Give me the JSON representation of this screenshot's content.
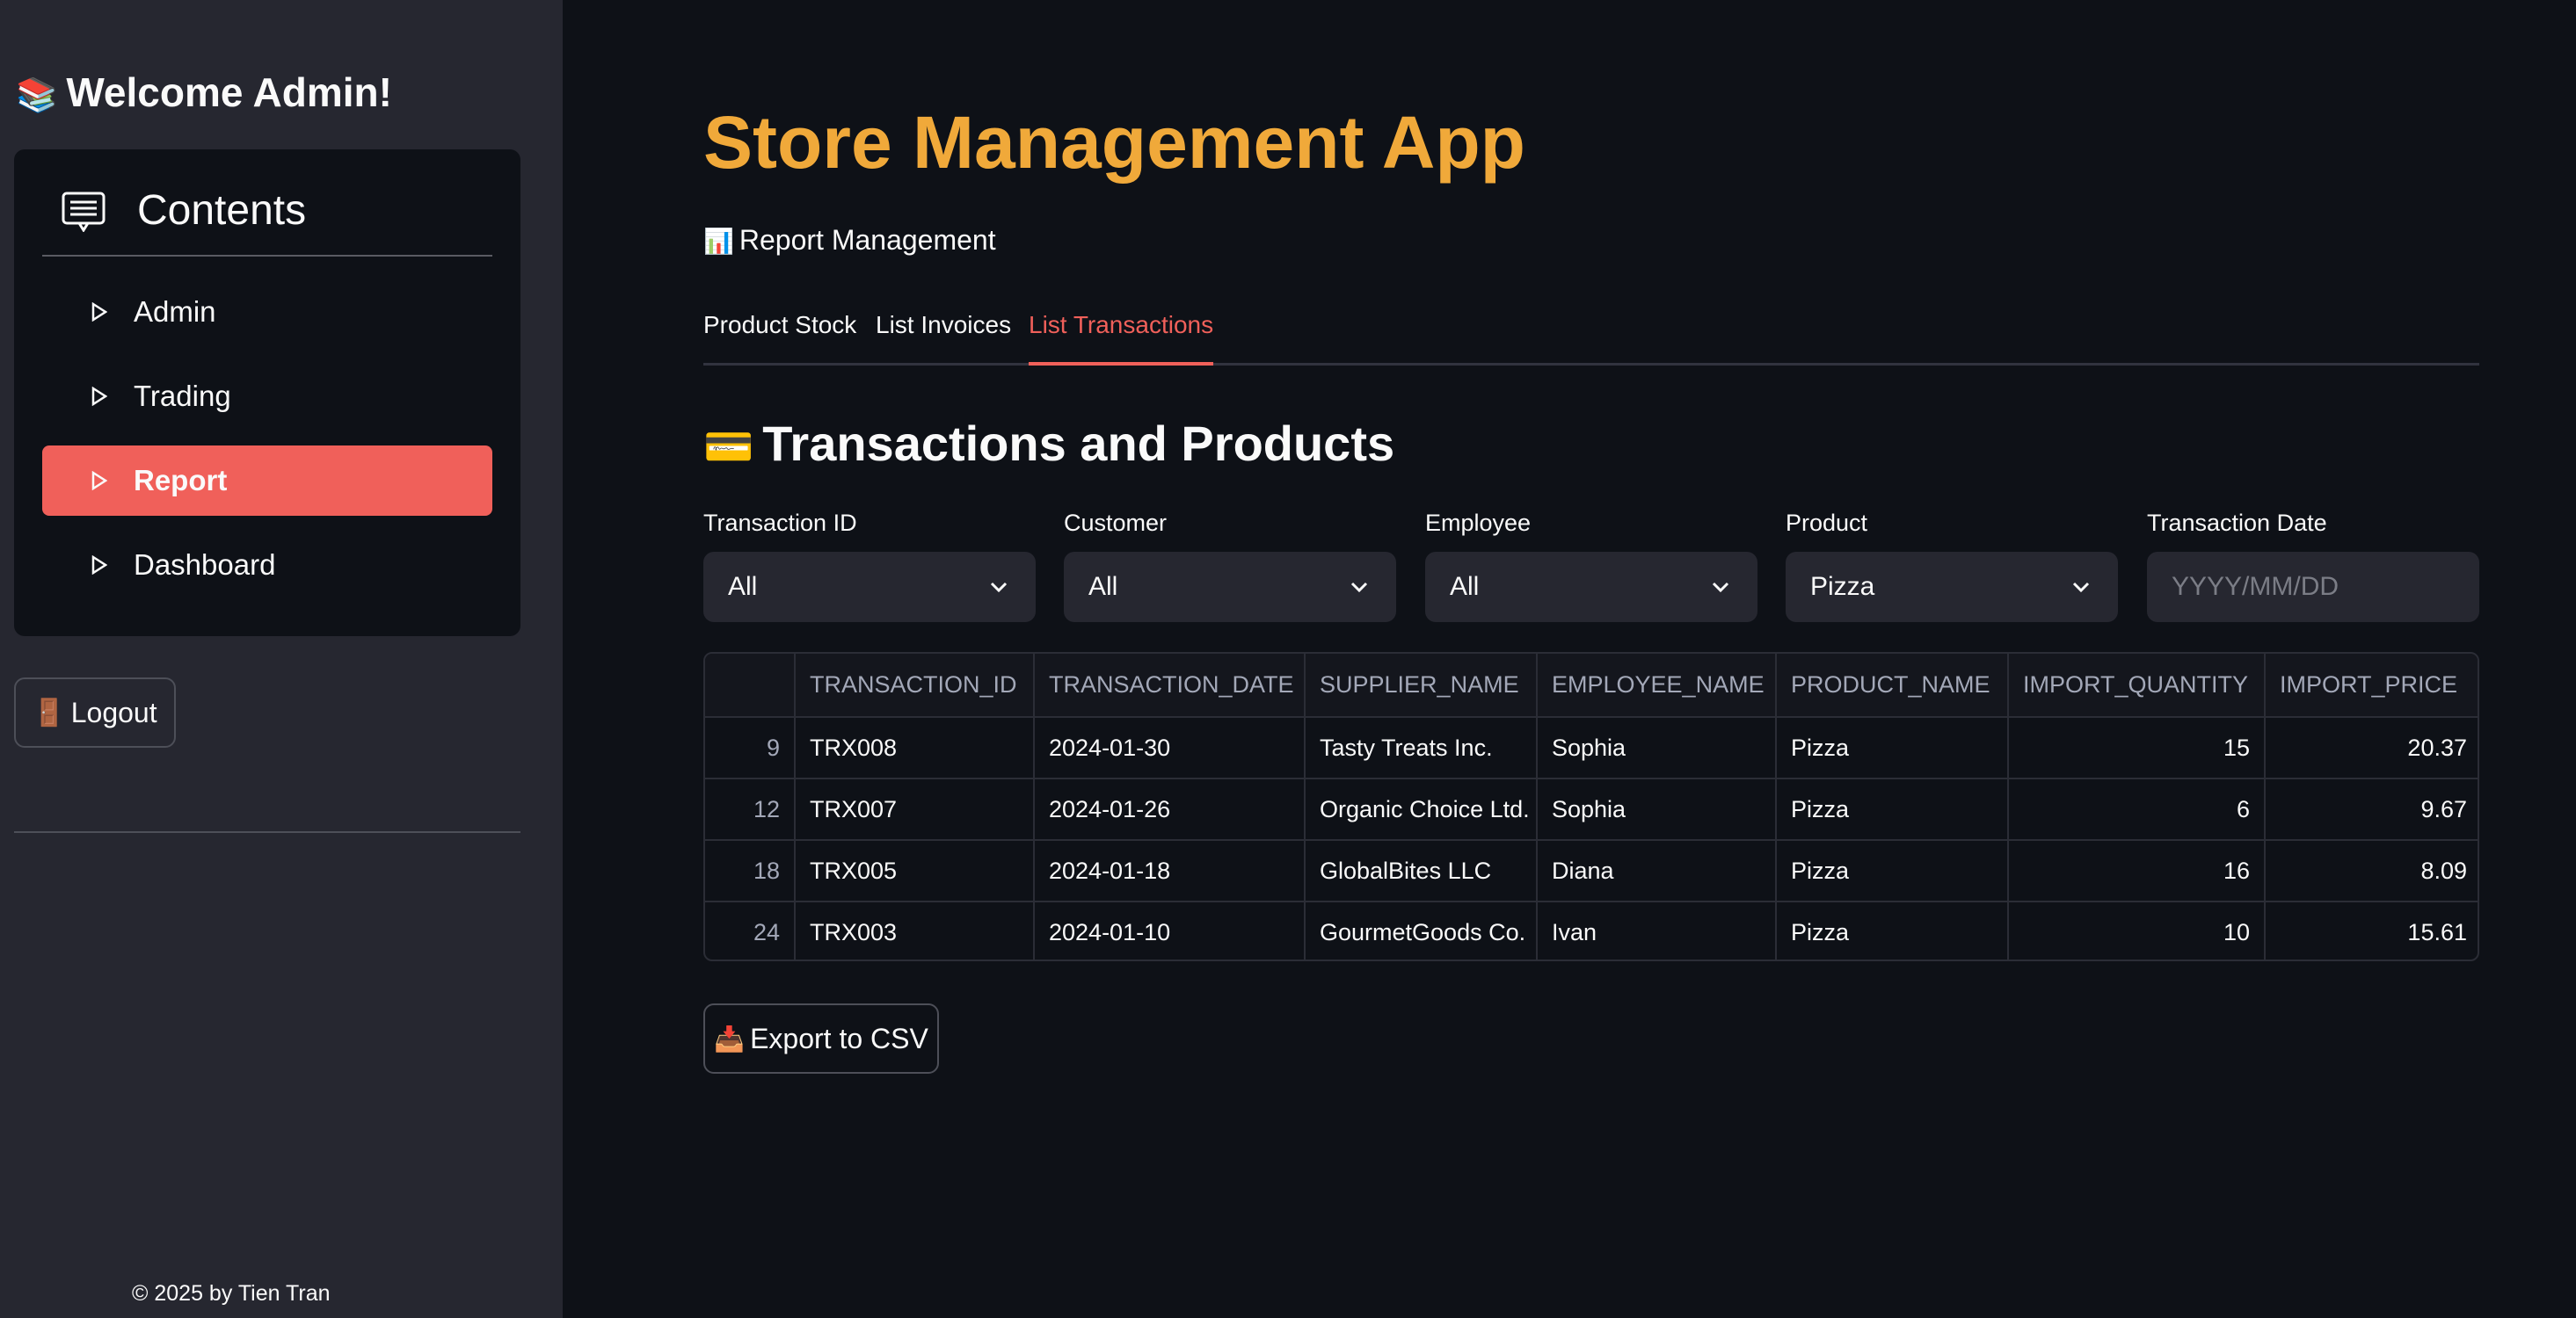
{
  "sidebar": {
    "welcome_emoji": "📚",
    "welcome": "Welcome Admin!",
    "menu_title": "Contents",
    "menu_icon": "card-list-icon",
    "items": [
      {
        "label": "Admin",
        "active": false
      },
      {
        "label": "Trading",
        "active": false
      },
      {
        "label": "Report",
        "active": true
      },
      {
        "label": "Dashboard",
        "active": false
      }
    ],
    "logout_emoji": "🚪",
    "logout_label": "Logout",
    "footer": "© 2025 by Tien Tran"
  },
  "main": {
    "title": "Store Management App",
    "subheader_emoji": "📊",
    "subheader": "Report Management",
    "tabs": [
      {
        "label": "Product Stock",
        "active": false
      },
      {
        "label": "List Invoices",
        "active": false
      },
      {
        "label": "List Transactions",
        "active": true
      }
    ],
    "section_emoji": "💳",
    "section_title": "Transactions and Products",
    "filters": [
      {
        "label": "Transaction ID",
        "value": "All",
        "placeholder": ""
      },
      {
        "label": "Customer",
        "value": "All",
        "placeholder": ""
      },
      {
        "label": "Employee",
        "value": "All",
        "placeholder": ""
      },
      {
        "label": "Product",
        "value": "Pizza",
        "placeholder": ""
      },
      {
        "label": "Transaction Date",
        "value": "",
        "placeholder": "YYYY/MM/DD"
      }
    ],
    "table": {
      "columns": [
        "",
        "TRANSACTION_ID",
        "TRANSACTION_DATE",
        "SUPPLIER_NAME",
        "EMPLOYEE_NAME",
        "PRODUCT_NAME",
        "IMPORT_QUANTITY",
        "IMPORT_PRICE"
      ],
      "rows": [
        [
          "9",
          "TRX008",
          "2024-01-30",
          "Tasty Treats Inc.",
          "Sophia",
          "Pizza",
          "15",
          "20.37"
        ],
        [
          "12",
          "TRX007",
          "2024-01-26",
          "Organic Choice Ltd.",
          "Sophia",
          "Pizza",
          "6",
          "9.67"
        ],
        [
          "18",
          "TRX005",
          "2024-01-18",
          "GlobalBites LLC",
          "Diana",
          "Pizza",
          "16",
          "8.09"
        ],
        [
          "24",
          "TRX003",
          "2024-01-10",
          "GourmetGoods Co.",
          "Ivan",
          "Pizza",
          "10",
          "15.61"
        ]
      ]
    },
    "export_emoji": "📥",
    "export_label": "Export to CSV"
  },
  "colors": {
    "accent": "#f0605a",
    "title": "#f0a93a",
    "background": "#0e1117",
    "sidebar": "#262730"
  }
}
